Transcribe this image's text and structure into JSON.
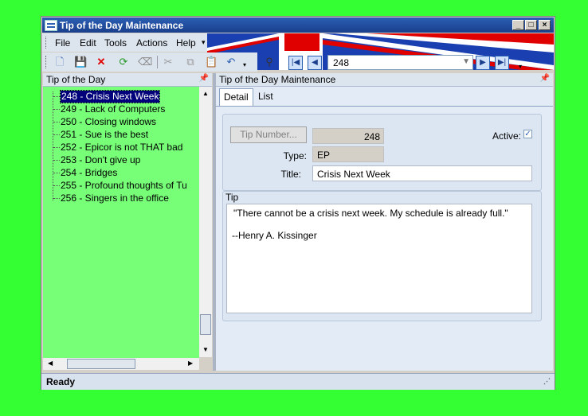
{
  "window": {
    "title": "Tip of the Day Maintenance"
  },
  "menu": {
    "items": [
      "File",
      "Edit",
      "Tools",
      "Actions",
      "Help"
    ]
  },
  "navigator": {
    "value": "248"
  },
  "left_pane": {
    "title": "Tip of the Day",
    "items": [
      "248 - Crisis Next Week",
      "249 - Lack of Computers",
      "250 - Closing windows",
      "251 - Sue is the best",
      "252 - Epicor is not THAT bad",
      "253 - Don't give up",
      "254 - Bridges",
      "255 - Profound thoughts of Tu",
      "256 - Singers in the office"
    ],
    "selected_index": 0
  },
  "right_pane": {
    "title": "Tip of the Day Maintenance",
    "tabs": [
      "Detail",
      "List"
    ],
    "active_tab": 0,
    "tip_number_button": "Tip Number...",
    "tip_number": "248",
    "active_label": "Active:",
    "active_checked": true,
    "type_label": "Type:",
    "type_value": "EP",
    "title_label": "Title:",
    "title_value": "Crisis Next Week",
    "tip_group_label": "Tip",
    "tip_line1": "\"There cannot be a crisis next week. My schedule is already full.\"",
    "tip_line2": "--Henry A. Kissinger"
  },
  "status": {
    "text": "Ready"
  },
  "colors": {
    "tree_bg": "#77ff77",
    "desktop_bg": "#33ff33",
    "title_bar": "#1a3f8c"
  }
}
